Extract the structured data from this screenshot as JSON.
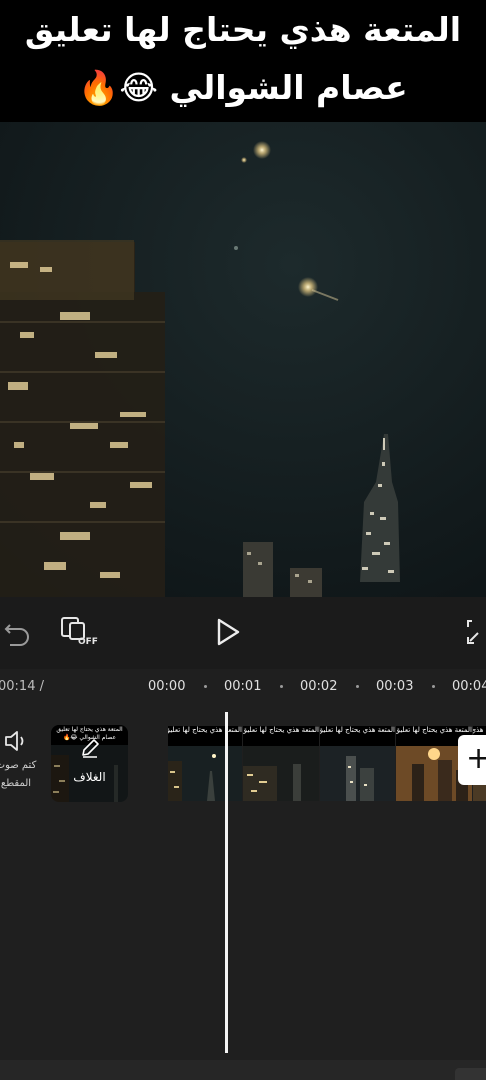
{
  "preview": {
    "caption_line1": "المتعة هذي يحتاج لها تعليق",
    "caption_line2": "عصام الشوالي 😂🔥"
  },
  "toolbar": {
    "undo_icon": "undo-icon",
    "cover_toggle_icon": "cover-off-icon",
    "cover_toggle_text": "OFF",
    "play_icon": "play-icon",
    "fullscreen_icon": "fullscreen-icon"
  },
  "timeline": {
    "current_time": "00:14 /",
    "ticks": [
      "00:00",
      "00:01",
      "00:02",
      "00:03",
      "00:04"
    ],
    "mute_label_1": "كتم صوت",
    "mute_label_2": "المقطع",
    "cover_label": "الغلاف",
    "cover_thumb_text": "المتعة هذي يحتاج لها تعليق عصام الشوالي 😂🔥",
    "frame_text": "المتعة هذي يحتاج لها تعليق عصام الشوالي 😂🔥",
    "add_label": "+"
  },
  "colors": {
    "background": "#1b1b1b",
    "timeline_bg": "#1f1f1f",
    "playhead": "#f4f4f4",
    "caption_bg": "#000000"
  }
}
